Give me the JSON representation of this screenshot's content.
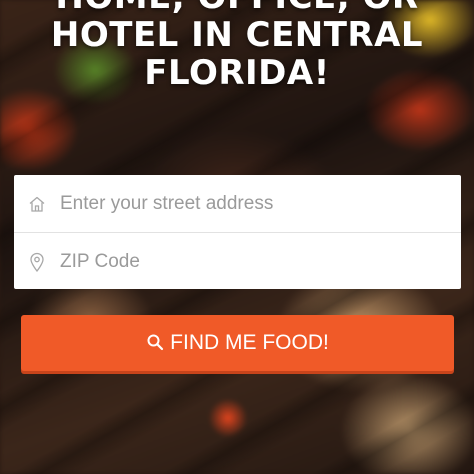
{
  "headline": {
    "line1": "HOME, OFFICE, OR",
    "line2": "HOTEL IN CENTRAL",
    "line3": "FLORIDA!"
  },
  "form": {
    "address_placeholder": "Enter your street address",
    "address_icon": "home-icon",
    "zip_placeholder": "ZIP Code",
    "zip_icon": "map-pin-icon"
  },
  "cta": {
    "label": "FIND ME FOOD!",
    "icon": "search-icon",
    "color": "#f05a28"
  }
}
